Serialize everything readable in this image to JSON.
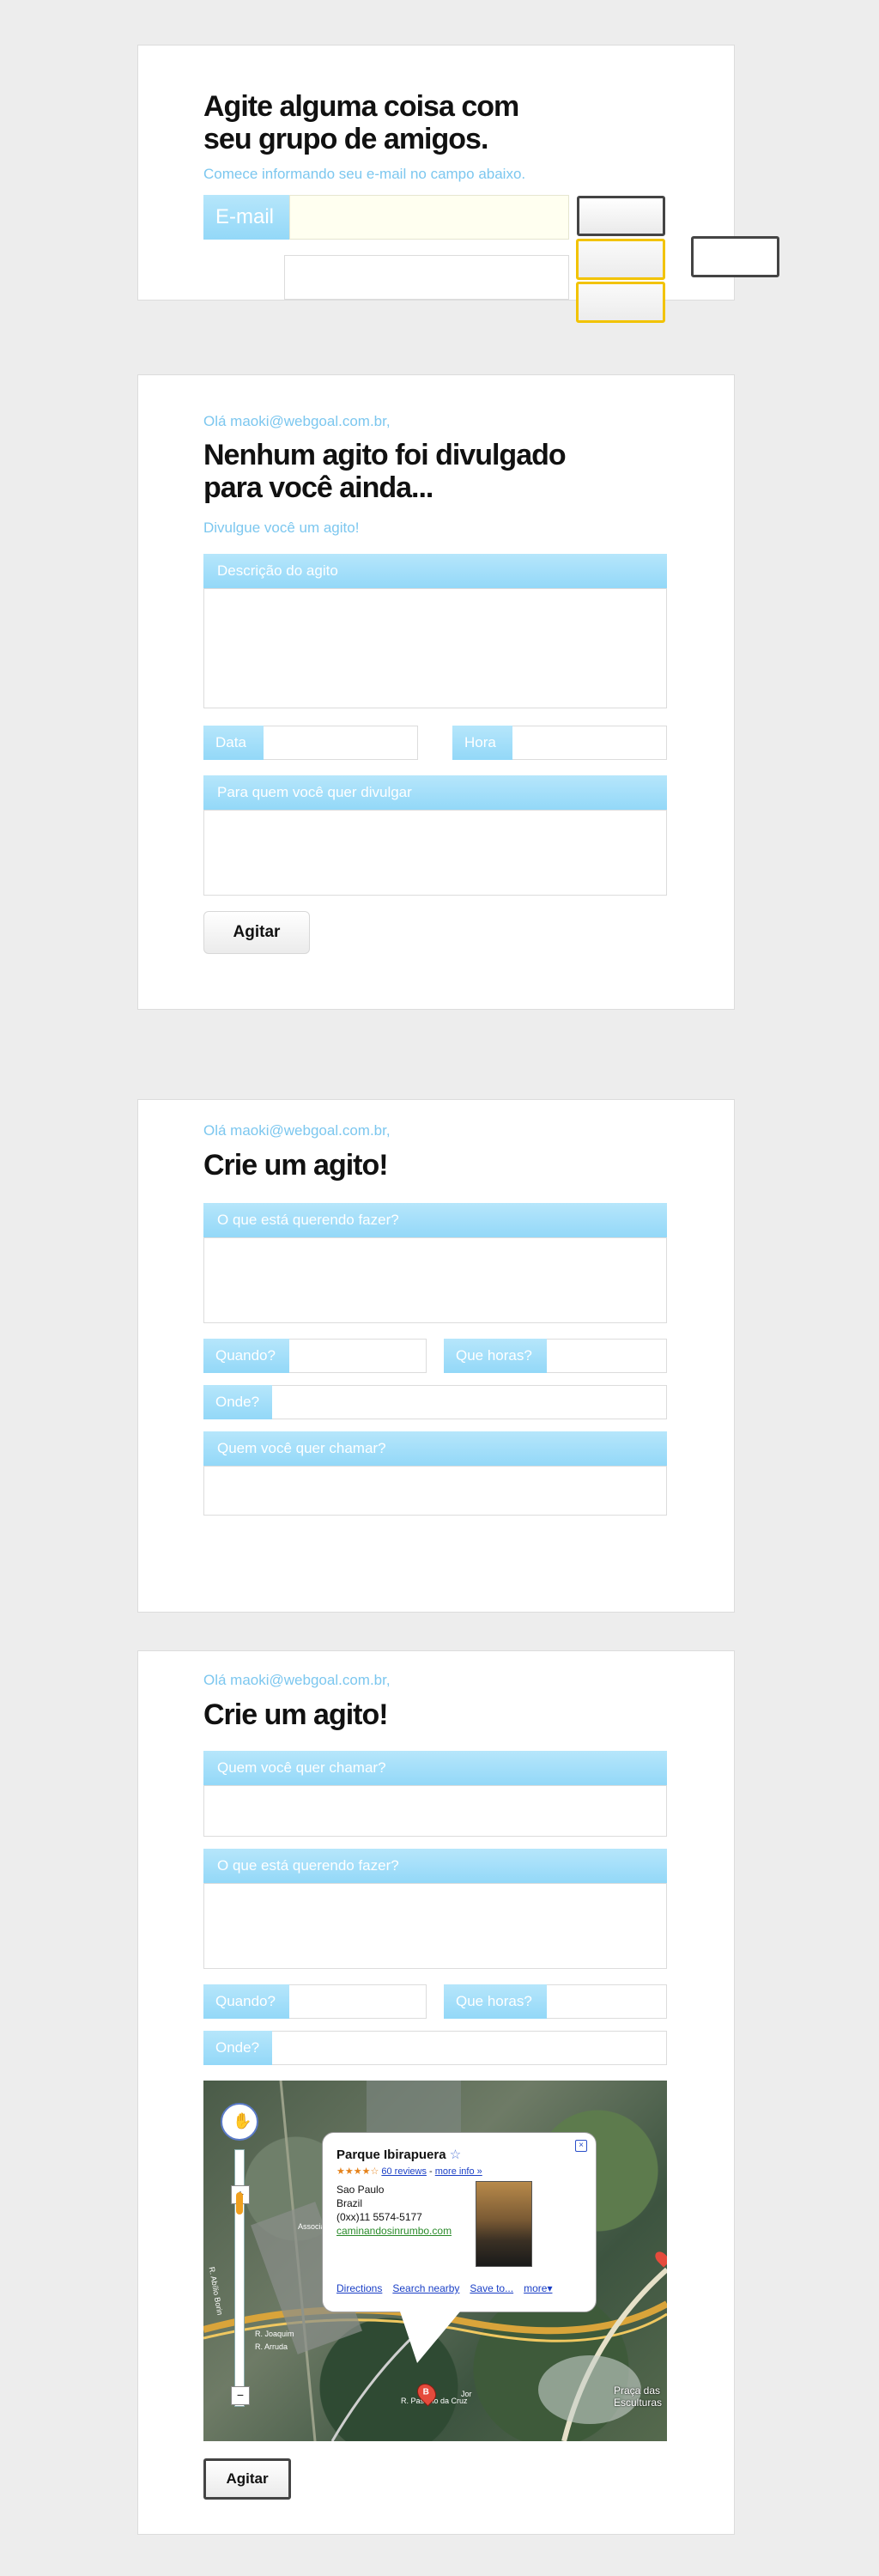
{
  "panel1": {
    "title_line1": "Agite alguma coisa com",
    "title_line2": "seu grupo de amigos.",
    "subtitle": "Comece informando seu e-mail no campo abaixo.",
    "email_label": "E-mail",
    "email_value": ""
  },
  "panel2": {
    "greeting": "Olá maoki@webgoal.com.br,",
    "title_line1": "Nenhum agito foi divulgado",
    "title_line2": "para você ainda...",
    "subtitle": "Divulgue você um agito!",
    "desc_label": "Descrição do agito",
    "date_label": "Data",
    "time_label": "Hora",
    "recipients_label": "Para quem você quer divulgar",
    "submit_label": "Agitar"
  },
  "panel3": {
    "greeting": "Olá maoki@webgoal.com.br,",
    "title": "Crie um agito!",
    "what_label": "O que está querendo fazer?",
    "when_label": "Quando?",
    "time_label": "Que horas?",
    "where_label": "Onde?",
    "who_label": "Quem você quer chamar?"
  },
  "panel4": {
    "greeting": "Olá maoki@webgoal.com.br,",
    "title": "Crie um agito!",
    "who_label": "Quem você quer chamar?",
    "what_label": "O que está querendo fazer?",
    "when_label": "Quando?",
    "time_label": "Que horas?",
    "where_label": "Onde?",
    "submit_label": "Agitar",
    "map": {
      "place_name": "Parque Ibirapuera",
      "reviews_link": "60 reviews",
      "more_info_link": "more info »",
      "separator": "-",
      "rating_stars": "★★★★☆",
      "address_line1": "Sao Paulo",
      "address_line2": "Brazil",
      "phone": "(0xx)11 5574-5177",
      "website": "caminandosinrumbo.com",
      "links": [
        "Directions",
        "Search nearby",
        "Save to...",
        "more▾"
      ],
      "marker_letter": "B",
      "poi_label1": "Praça das",
      "poi_label2": "Esculturas",
      "road_label1": "Associação",
      "road_label2": "R. Abílio Borin",
      "road_label3": "R. Joaquim",
      "road_label4": "R. Arruda",
      "road_label5": "Jor",
      "road_label6": "R. Passeio da Cruz"
    }
  },
  "colors": {
    "label_blue": "#9fdcf8",
    "subtitle_blue": "#7cc7ef",
    "button_yellow": "#f2c300",
    "email_field_bg": "#fffff0"
  }
}
